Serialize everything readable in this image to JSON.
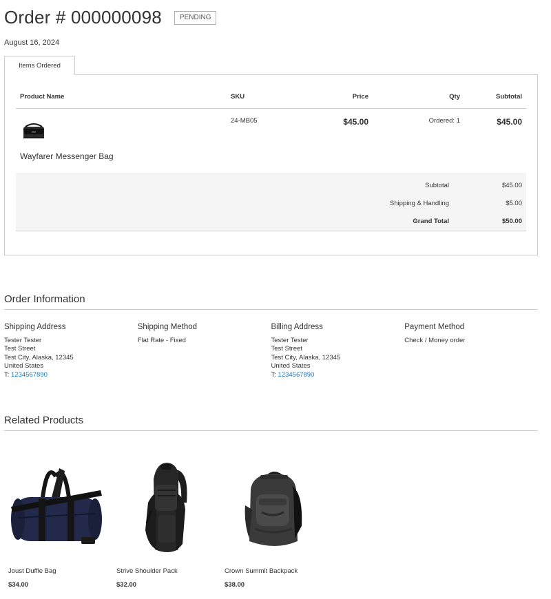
{
  "order": {
    "title": "Order # 000000098",
    "status": "PENDING",
    "date": "August 16, 2024"
  },
  "tabs": [
    {
      "label": "Items Ordered"
    }
  ],
  "items_table": {
    "headers": {
      "product_name": "Product Name",
      "sku": "SKU",
      "price": "Price",
      "qty": "Qty",
      "subtotal": "Subtotal"
    },
    "rows": [
      {
        "product_name": "Wayfarer Messenger Bag",
        "sku": "24-MB05",
        "price": "$45.00",
        "qty": "Ordered: 1",
        "subtotal": "$45.00"
      }
    ]
  },
  "totals": {
    "subtotal_label": "Subtotal",
    "subtotal_value": "$45.00",
    "shipping_label": "Shipping & Handling",
    "shipping_value": "$5.00",
    "grand_total_label": "Grand Total",
    "grand_total_value": "$50.00"
  },
  "order_information": {
    "title": "Order Information",
    "shipping_address": {
      "heading": "Shipping Address",
      "name": "Tester Tester",
      "street": "Test Street",
      "city_line": "Test City, Alaska, 12345",
      "country": "United States",
      "phone_prefix": "T: ",
      "phone": "1234567890"
    },
    "shipping_method": {
      "heading": "Shipping Method",
      "value": "Flat Rate - Fixed"
    },
    "billing_address": {
      "heading": "Billing Address",
      "name": "Tester Tester",
      "street": "Test Street",
      "city_line": "Test City, Alaska, 12345",
      "country": "United States",
      "phone_prefix": "T: ",
      "phone": "1234567890"
    },
    "payment_method": {
      "heading": "Payment Method",
      "value": "Check / Money order"
    }
  },
  "related_products": {
    "title": "Related Products",
    "items": [
      {
        "name": "Joust Duffle Bag",
        "price": "$34.00"
      },
      {
        "name": "Strive Shoulder Pack",
        "price": "$32.00"
      },
      {
        "name": "Crown Summit Backpack",
        "price": "$38.00"
      }
    ]
  },
  "colors": {
    "link": "#1979c3",
    "border": "#cccccc",
    "totals_background": "#f5f5f5",
    "text": "#333333"
  }
}
